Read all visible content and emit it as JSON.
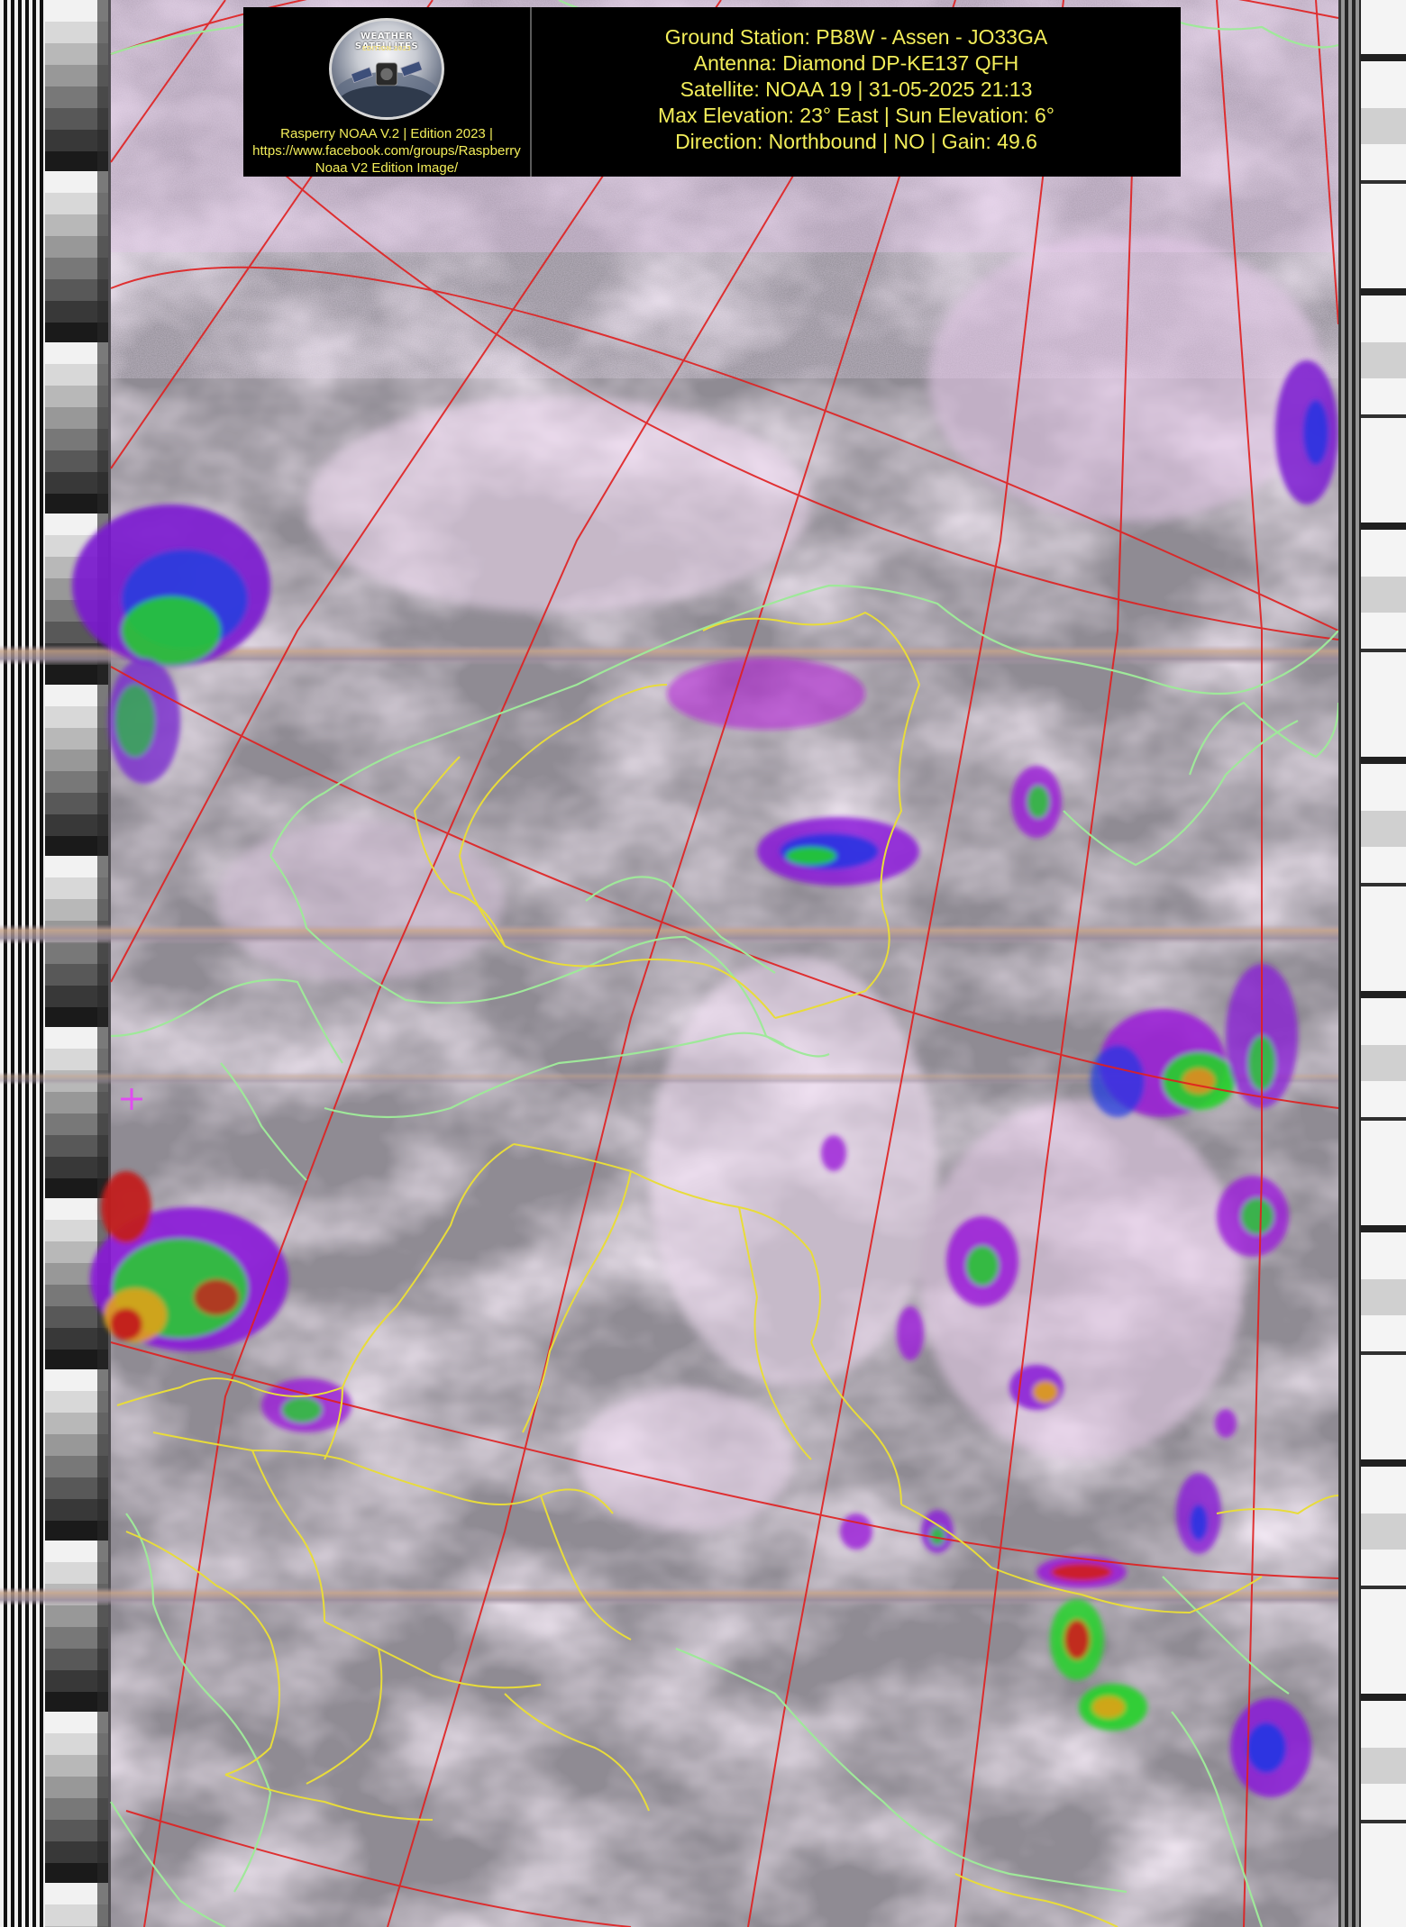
{
  "header": {
    "logo": {
      "title": "WEATHER SATELLITES",
      "edition": "EDITION 2023",
      "caption_lines": [
        "Rasperry NOAA V.2 | Edition 2023 |",
        "https://www.facebook.com/groups/Raspberry",
        "Noaa V2 Edition Image/"
      ]
    },
    "info_lines": [
      "Ground Station: PB8W - Assen - JO33GA",
      "Antenna: Diamond DP-KE137 QFH",
      "Satellite: NOAA 19 | 31-05-2025 21:13",
      "Max Elevation: 23° East | Sun Elevation: 6°",
      "Direction: Northbound | NO | Gain: 49.6"
    ]
  },
  "colors": {
    "header_text": "#f3ee5a",
    "header_background": "#000000",
    "grid_lines": "#e02020",
    "coastlines": "#9fe89a",
    "borders": "#e8dc3a",
    "cloud_base": "#8f8b93",
    "cloud_highlight": "#f2d9f4",
    "ir_magenta": "#c21ad8",
    "ir_green": "#23d22a",
    "ir_red": "#d01b1b",
    "crosshair": "#e04cf0"
  },
  "image": {
    "type": "NOAA APT infrared false-color satellite image with map overlay",
    "icons": [
      "satellite-logo-icon",
      "crosshair-marker-icon"
    ]
  }
}
